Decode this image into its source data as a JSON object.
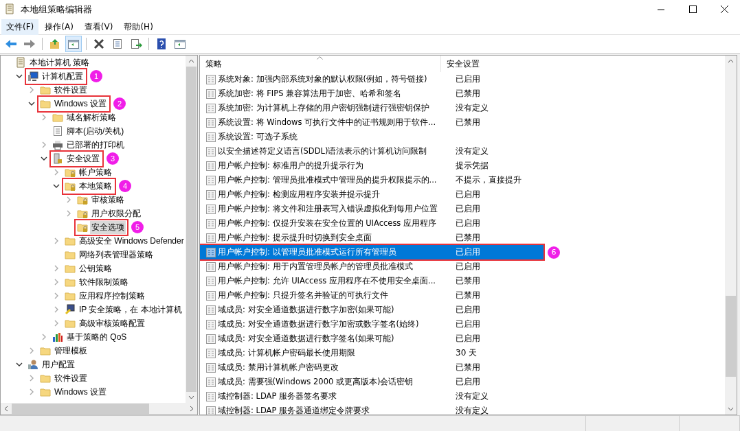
{
  "window": {
    "title": "本地组策略编辑器"
  },
  "menu": [
    {
      "label": "文件(F)",
      "selected": true
    },
    {
      "label": "操作(A)",
      "selected": false
    },
    {
      "label": "查看(V)",
      "selected": false
    },
    {
      "label": "帮助(H)",
      "selected": false
    }
  ],
  "toolbar": [
    {
      "kind": "back"
    },
    {
      "kind": "forward"
    },
    {
      "kind": "sep"
    },
    {
      "kind": "up"
    },
    {
      "kind": "pane",
      "selected": true
    },
    {
      "kind": "sep"
    },
    {
      "kind": "delete"
    },
    {
      "kind": "props"
    },
    {
      "kind": "export"
    },
    {
      "kind": "sep"
    },
    {
      "kind": "help"
    },
    {
      "kind": "pane2"
    }
  ],
  "tree": [
    {
      "label": "本地计算机 策略",
      "kind": "doc",
      "children": [
        {
          "label": "计算机配置",
          "kind": "computer",
          "expanded": true,
          "callout": "1",
          "children": [
            {
              "label": "软件设置",
              "kind": "folder",
              "expanded": false
            },
            {
              "label": "Windows 设置",
              "kind": "folder",
              "expanded": true,
              "callout": "2",
              "children": [
                {
                  "label": "域名解析策略",
                  "kind": "folder",
                  "expanded": false
                },
                {
                  "label": "脚本(启动/关机)",
                  "kind": "script"
                },
                {
                  "label": "已部署的打印机",
                  "kind": "printer",
                  "expanded": false
                },
                {
                  "label": "安全设置",
                  "kind": "security",
                  "expanded": true,
                  "callout": "3",
                  "children": [
                    {
                      "label": "帐户策略",
                      "kind": "lockfolder",
                      "expanded": false
                    },
                    {
                      "label": "本地策略",
                      "kind": "lockfolder",
                      "expanded": true,
                      "callout": "4",
                      "children": [
                        {
                          "label": "审核策略",
                          "kind": "lockfolder",
                          "expanded": false
                        },
                        {
                          "label": "用户权限分配",
                          "kind": "lockfolder",
                          "expanded": false
                        },
                        {
                          "label": "安全选项",
                          "kind": "lockfolder",
                          "selected": true,
                          "callout": "5"
                        }
                      ]
                    },
                    {
                      "label": "高级安全 Windows Defender",
                      "kind": "folder",
                      "expanded": false
                    },
                    {
                      "label": "网络列表管理器策略",
                      "kind": "folder"
                    },
                    {
                      "label": "公钥策略",
                      "kind": "folder",
                      "expanded": false
                    },
                    {
                      "label": "软件限制策略",
                      "kind": "folder",
                      "expanded": false
                    },
                    {
                      "label": "应用程序控制策略",
                      "kind": "folder",
                      "expanded": false
                    },
                    {
                      "label": "IP 安全策略，在 本地计算机",
                      "kind": "ip",
                      "expanded": false
                    },
                    {
                      "label": "高级审核策略配置",
                      "kind": "folder",
                      "expanded": false
                    }
                  ]
                },
                {
                  "label": "基于策略的 QoS",
                  "kind": "chart",
                  "expanded": false
                }
              ]
            },
            {
              "label": "管理模板",
              "kind": "folder",
              "expanded": false
            }
          ]
        },
        {
          "label": "用户配置",
          "kind": "user",
          "expanded": true,
          "children": [
            {
              "label": "软件设置",
              "kind": "folder",
              "expanded": false
            },
            {
              "label": "Windows 设置",
              "kind": "folder",
              "expanded": false
            }
          ]
        }
      ]
    }
  ],
  "table": {
    "columns": [
      "策略",
      "安全设置"
    ],
    "rows": [
      {
        "policy": "系统对象: 加强内部系统对象的默认权限(例如，符号链接)",
        "setting": "已启用",
        "selected": false
      },
      {
        "policy": "系统加密: 将 FIPS 兼容算法用于加密、哈希和签名",
        "setting": "已禁用",
        "selected": false
      },
      {
        "policy": "系统加密: 为计算机上存储的用户密钥强制进行强密钥保护",
        "setting": "没有定义",
        "selected": false
      },
      {
        "policy": "系统设置: 将 Windows 可执行文件中的证书规则用于软件...",
        "setting": "已禁用",
        "selected": false
      },
      {
        "policy": "系统设置: 可选子系统",
        "selected": false
      },
      {
        "policy": "以安全描述符定义语言(SDDL)语法表示的计算机访问限制",
        "setting": "没有定义",
        "selected": false
      },
      {
        "policy": "用户帐户控制: 标准用户的提升提示行为",
        "setting": "提示凭据",
        "selected": false
      },
      {
        "policy": "用户帐户控制: 管理员批准模式中管理员的提升权限提示的...",
        "setting": "不提示，直接提升",
        "selected": false
      },
      {
        "policy": "用户帐户控制: 检测应用程序安装并提示提升",
        "setting": "已启用",
        "selected": false
      },
      {
        "policy": "用户帐户控制: 将文件和注册表写入错误虚拟化到每用户位置",
        "setting": "已启用",
        "selected": false
      },
      {
        "policy": "用户帐户控制: 仅提升安装在安全位置的 UIAccess 应用程序",
        "setting": "已启用",
        "selected": false
      },
      {
        "policy": "用户帐户控制: 提示提升时切换到安全桌面",
        "setting": "已禁用",
        "selected": false
      },
      {
        "policy": "用户帐户控制: 以管理员批准模式运行所有管理员",
        "setting": "已启用",
        "selected": true,
        "callout": "6"
      },
      {
        "policy": "用户帐户控制: 用于内置管理员帐户的管理员批准模式",
        "setting": "已启用",
        "selected": false
      },
      {
        "policy": "用户帐户控制: 允许 UIAccess 应用程序在不使用安全桌面...",
        "setting": "已禁用",
        "selected": false
      },
      {
        "policy": "用户帐户控制: 只提升签名并验证的可执行文件",
        "setting": "已禁用",
        "selected": false
      },
      {
        "policy": "域成员: 对安全通道数据进行数字加密(如果可能)",
        "setting": "已启用",
        "selected": false
      },
      {
        "policy": "域成员: 对安全通道数据进行数字加密或数字签名(始终)",
        "setting": "已启用",
        "selected": false
      },
      {
        "policy": "域成员: 对安全通道数据进行数字签名(如果可能)",
        "setting": "已启用",
        "selected": false
      },
      {
        "policy": "域成员: 计算机帐户密码最长使用期限",
        "setting": "30 天",
        "selected": false
      },
      {
        "policy": "域成员: 禁用计算机帐户密码更改",
        "setting": "已禁用",
        "selected": false
      },
      {
        "policy": "域成员: 需要强(Windows 2000 或更高版本)会话密钥",
        "setting": "已启用",
        "selected": false
      },
      {
        "policy": "域控制器: LDAP 服务器签名要求",
        "setting": "没有定义",
        "selected": false
      },
      {
        "policy": "域控制器: LDAP 服务器通道绑定令牌要求",
        "setting": "没有定义",
        "selected": false
      }
    ]
  }
}
